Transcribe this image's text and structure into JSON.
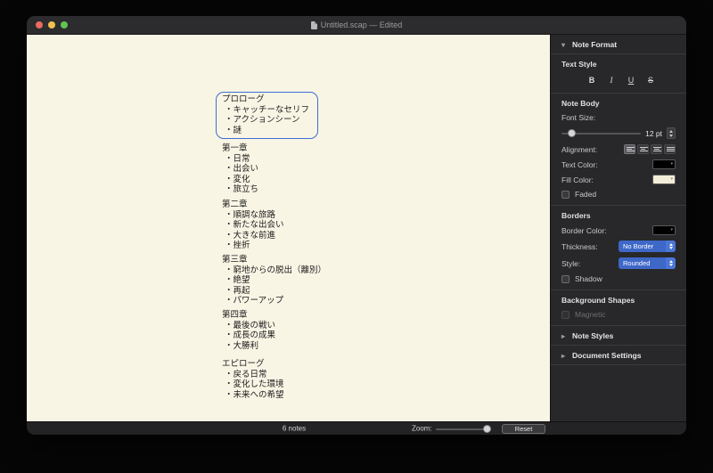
{
  "window": {
    "title": "Untitled.scap — Edited"
  },
  "icons": {
    "disclosure_open": "▾",
    "disclosure_closed": "▸",
    "well_arrow": "▾"
  },
  "canvas": {
    "notes": [
      {
        "title": "プロローグ",
        "selected": true,
        "items": [
          "・キャッチーなセリフ",
          "・アクションシーン",
          "・謎"
        ]
      },
      {
        "title": "第一章",
        "items": [
          "・日常",
          "・出会い",
          "・変化",
          "・旅立ち"
        ]
      },
      {
        "title": "第二章",
        "items": [
          "・順調な旅路",
          "・新たな出会い",
          "・大きな前進",
          "・挫折"
        ]
      },
      {
        "title": "第三章",
        "items": [
          "・窮地からの脱出（離別）",
          "・絶望",
          "・再起",
          "・パワーアップ"
        ]
      },
      {
        "title": "第四章",
        "items": [
          "・最後の戦い",
          "・成長の成果",
          "・大勝利"
        ]
      },
      {
        "title": "エピローグ",
        "items": [
          "・戻る日常",
          "・変化した環境",
          "・未来への希望"
        ]
      }
    ]
  },
  "inspector": {
    "note_format_label": "Note Format",
    "text_style": {
      "label": "Text Style",
      "buttons": [
        "B",
        "I",
        "U",
        "S"
      ]
    },
    "note_body": {
      "label": "Note Body",
      "font_size_label": "Font Size:",
      "font_size_value": "12 pt",
      "alignment_label": "Alignment:",
      "text_color_label": "Text Color:",
      "fill_color_label": "Fill Color:",
      "faded_label": "Faded"
    },
    "borders": {
      "label": "Borders",
      "border_color_label": "Border Color:",
      "thickness_label": "Thickness:",
      "thickness_value": "No Border",
      "style_label": "Style:",
      "style_value": "Rounded",
      "shadow_label": "Shadow"
    },
    "background_shapes": {
      "label": "Background Shapes",
      "magnetic_label": "Magnetic"
    },
    "note_styles_label": "Note Styles",
    "document_settings_label": "Document Settings"
  },
  "status_bar": {
    "notes_count": "6 notes",
    "zoom_label": "Zoom:",
    "reset_label": "Reset"
  },
  "colors": {
    "accent_blue": "#3e68c8",
    "selection_border": "#3b6ed2",
    "canvas_bg": "#f9f5e5",
    "text_color_swatch": "#000000",
    "fill_color_swatch": "#f2ecd8",
    "border_color_swatch": "#000000"
  }
}
